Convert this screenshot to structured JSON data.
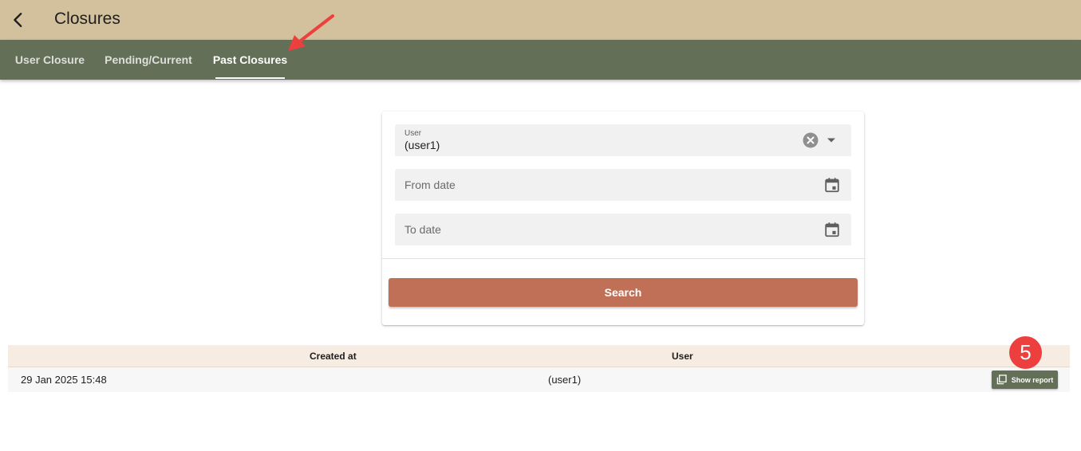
{
  "header": {
    "title": "Closures",
    "back_icon": "chevron-left-icon"
  },
  "tabs": [
    {
      "label": "User Closure",
      "active": false
    },
    {
      "label": "Pending/Current",
      "active": false
    },
    {
      "label": "Past Closures",
      "active": true
    }
  ],
  "search_form": {
    "user_field": {
      "label": "User",
      "value": "(user1)"
    },
    "from_date": {
      "placeholder": "From date"
    },
    "to_date": {
      "placeholder": "To date"
    },
    "search_label": "Search"
  },
  "table": {
    "columns": [
      "Created at",
      "User"
    ],
    "rows": [
      {
        "created_at": "29 Jan 2025 15:48",
        "user": "(user1)",
        "action_label": "Show report"
      }
    ]
  },
  "annotation": {
    "step_number": "5"
  },
  "colors": {
    "topbar": "#d2c19c",
    "tabbar": "#636f57",
    "search_button": "#c07056",
    "table_header": "#f6ece2",
    "step_badge": "#ee3f3f",
    "annotation_arrow": "#ee3f3f"
  }
}
